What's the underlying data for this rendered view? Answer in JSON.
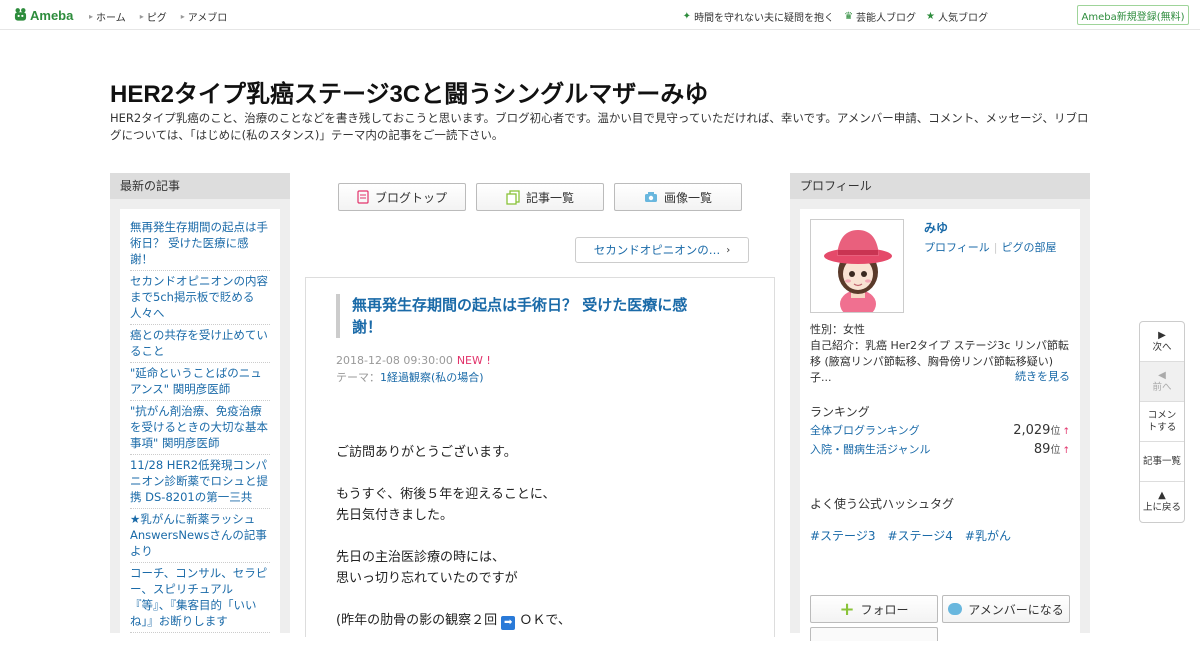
{
  "topbar": {
    "brand": "Ameba",
    "nav": [
      "ホーム",
      "ピグ",
      "アメブロ"
    ],
    "right_links": [
      {
        "label": "時間を守れない夫に疑問を抱く",
        "icon": "sparkle-icon"
      },
      {
        "label": "芸能人ブログ",
        "icon": "crown-icon"
      },
      {
        "label": "人気ブログ",
        "icon": "star-icon"
      }
    ],
    "register": "Ameba新規登録(無料)"
  },
  "header": {
    "title": "HER2タイプ乳癌ステージ3Cと闘うシングルマザーみゆ",
    "description": "HER2タイプ乳癌のこと、治療のことなどを書き残しておこうと思います。ブログ初心者です。温かい目で見守っていただければ、幸いです。アメンバー申請、コメント、メッセージ、リブログについては、「はじめに(私のスタンス)」テーマ内の記事をご一読下さい。"
  },
  "left": {
    "heading": "最新の記事",
    "items": [
      "無再発生存期間の起点は手術日？ 受けた医療に感謝！",
      "セカンドオピニオンの内容まで5ch掲示板で貶める人々へ",
      "癌との共存を受け止めていること",
      "\"延命ということばのニュアンス\" 関明彦医師",
      "\"抗がん剤治療、免疫治療を受けるときの大切な基本事項\" 関明彦医師",
      "11/28 HER2低発現コンパニオン診断薬でロシュと提携 DS-8201の第一三共",
      "★乳がんに新薬ラッシュ AnswersNewsさんの記事より",
      "コーチ、コンサル、セラピー、スピリチュアル『等』、『集客目的「いいね」』お断りします"
    ]
  },
  "center": {
    "nav": [
      {
        "label": "ブログトップ",
        "icon": "blog-top-icon"
      },
      {
        "label": "記事一覧",
        "icon": "article-list-icon"
      },
      {
        "label": "画像一覧",
        "icon": "camera-icon"
      }
    ],
    "next_article": "セカンドオピニオンの…",
    "article": {
      "title": "無再発生存期間の起点は手術日？ 受けた医療に感謝！",
      "datetime": "2018-12-08 09:30:00",
      "new_badge": "NEW !",
      "theme_label": "テーマ：",
      "theme": "1経過観察(私の場合)",
      "body": [
        [
          "ご訪問ありがとうございます。"
        ],
        [
          "もうすぐ、術後５年を迎えることに、",
          "先日気付きました。"
        ],
        [
          "先日の主治医診療の時には、",
          "思いっ切り忘れていたのですが"
        ]
      ],
      "body_last_prefix": "(昨年の肋骨の影の観察２回",
      "body_last_emoji": "➡",
      "body_last_suffix": " ＯＫで、"
    }
  },
  "right": {
    "heading": "プロフィール",
    "name": "みゆ",
    "links": [
      "プロフィール",
      "ピグの部屋"
    ],
    "gender": "性別：女性",
    "intro": "自己紹介：乳癌 Her2タイプ ステージ3c リンパ節転移 (腋窩リンパ節転移、胸骨傍リンパ節転移疑い) 子...",
    "see_more": "続きを見る",
    "ranking_heading": "ランキング",
    "rankings": [
      {
        "label": "全体ブログランキング",
        "value": "2,029",
        "unit": "位",
        "trend": "↑"
      },
      {
        "label": "入院・闘病生活ジャンル",
        "value": "89",
        "unit": "位",
        "trend": "↑"
      }
    ],
    "hashtag_heading": "よく使う公式ハッシュタグ",
    "hashtags": [
      "#ステージ3",
      "#ステージ4",
      "#乳がん"
    ],
    "follow": "フォロー",
    "amember": "アメンバーになる"
  },
  "sidenav": [
    {
      "label": "次へ",
      "icon": "▶",
      "disabled": false
    },
    {
      "label": "前へ",
      "icon": "◀",
      "disabled": true
    },
    {
      "label": "コメントする",
      "icon": "",
      "disabled": false
    },
    {
      "label": "記事一覧",
      "icon": "",
      "disabled": false
    },
    {
      "label": "上に戻る",
      "icon": "▲",
      "disabled": false
    }
  ],
  "colors": {
    "brand_green": "#2d8c3c",
    "link_blue": "#1a6aa8",
    "new_pink": "#e2336b"
  }
}
